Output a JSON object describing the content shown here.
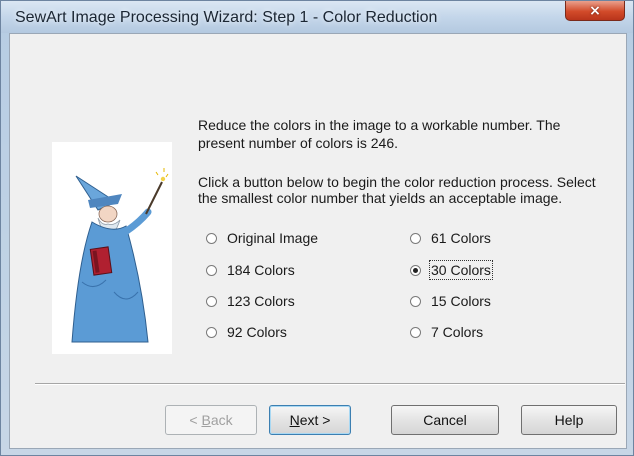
{
  "window": {
    "title": "SewArt Image Processing Wizard: Step 1 - Color Reduction",
    "close_glyph": "×"
  },
  "intro_text": "Reduce the colors in the image to a workable number. The present number of colors is 246.",
  "instruction_text": "Click a button below to begin the color reduction process. Select the smallest color number that yields an acceptable image.",
  "options": {
    "original": "Original Image",
    "c184": "184 Colors",
    "c123": "123 Colors",
    "c92": "92 Colors",
    "c61": "61 Colors",
    "c30": "30 Colors",
    "c15": "15 Colors",
    "c7": "7 Colors"
  },
  "selected_option": "30 Colors",
  "buttons": {
    "back_prefix": "< ",
    "back_key": "B",
    "back_rest": "ack",
    "next_key": "N",
    "next_rest": "ext >",
    "cancel": "Cancel",
    "help": "Help"
  },
  "colors": {
    "accent_blue": "#3c7fb1",
    "wizard_robe": "#5b9bd5",
    "wizard_book": "#b02030"
  },
  "icons": {
    "wizard": "wizard-illustration",
    "close": "close-icon"
  }
}
